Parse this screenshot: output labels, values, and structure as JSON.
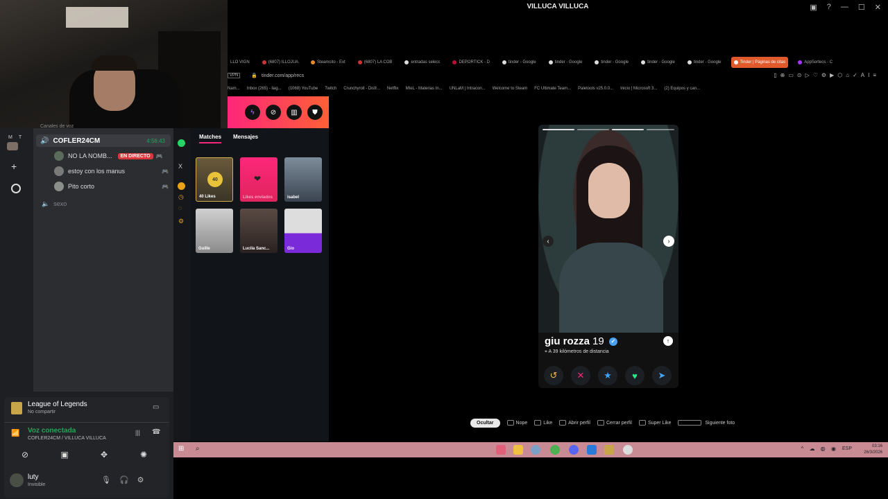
{
  "window": {
    "title": "VILLUCA VILLUCA"
  },
  "discord": {
    "guild_letters": [
      "M",
      "T"
    ],
    "channels_header": "Canales de voz",
    "voice_channel": {
      "name": "COFLER24CM",
      "timer": "4:56:43"
    },
    "members": [
      {
        "name": "NO LA NOMB...",
        "badge": "EN DIRECTO"
      },
      {
        "name": "estoy con los manus",
        "badge": ""
      },
      {
        "name": "Pito corto",
        "badge": ""
      }
    ],
    "other_channel": "sexo",
    "activity": {
      "game": "League of Legends",
      "sub": "No compartir"
    },
    "voice": {
      "status": "Voz conectada",
      "location": "COFLER24CM / VILLUCA VILLUCA"
    },
    "user": {
      "name": "luty",
      "status": "Invisible"
    }
  },
  "browser": {
    "tabs": [
      "LLO VIGN",
      "(6807) ILLOJUA",
      "Steamcito - Ext",
      "(6807) LA COB",
      "entradas selecc",
      "DEPORTICK - D",
      "tinder - Google",
      "tinder - Google",
      "tinder - Google",
      "tinder - Google",
      "tinder - Google",
      "Tinder | Páginas de citas",
      "AppSorteos - C"
    ],
    "url": "tinder.com/app/recs",
    "bookmarks": [
      "Nam...",
      "Inbox (265) - liag...",
      "(1068) YouTube",
      "Twitch",
      "Crunchyroll - Disfr...",
      "Netflix",
      "MIeL - Materias In...",
      "UNLaM | Intracon...",
      "Welcome to Steam",
      "FC Ultimate Team...",
      "Paletools v25.0.0...",
      "Inicio | Microsoft 3...",
      "(2) Equipos y can..."
    ]
  },
  "tinder": {
    "tabs": {
      "matches": "Matches",
      "messages": "Mensajes"
    },
    "likes": {
      "count": "40",
      "label": "40 Likes"
    },
    "sent_label": "Likes enviados",
    "matches": [
      "isabel",
      "Guille",
      "Lucila Sanc...",
      "Gio"
    ],
    "profile": {
      "name": "giu rozza",
      "age": "19",
      "distance": "A 39 kilómetros de distancia"
    },
    "shortcuts": {
      "hide": "Ocultar",
      "nope": "Nope",
      "like": "Like",
      "open": "Abrir perfil",
      "close": "Cerrar perfil",
      "superlike": "Super Like",
      "next": "Siguiente foto"
    }
  },
  "taskbar": {
    "time": "03:16",
    "date": "26/3/2026",
    "lang": "ESP"
  },
  "colors": {
    "tinder_gradient_start": "#fd267a",
    "tinder_gradient_end": "#ff6036",
    "live_red": "#da373c",
    "voice_green": "#23a55a"
  }
}
